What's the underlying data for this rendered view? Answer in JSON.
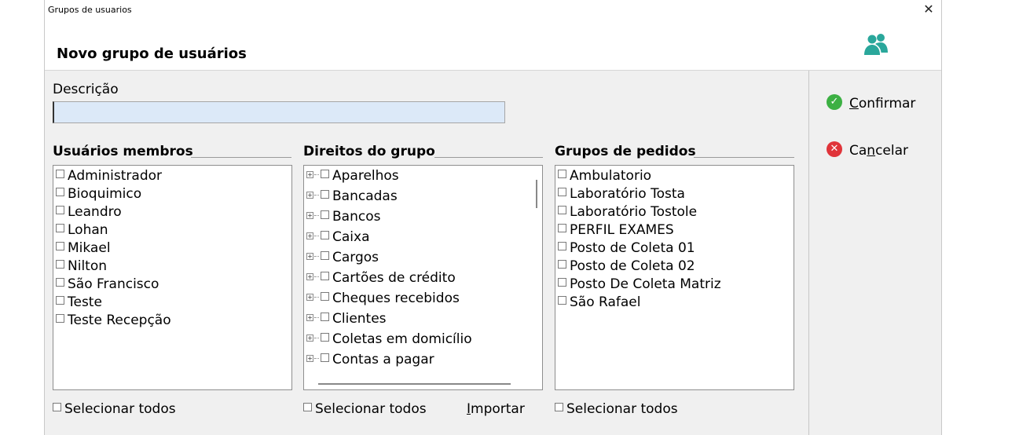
{
  "window": {
    "title": "Grupos de usuarios",
    "close_glyph": "✕"
  },
  "header": {
    "heading": "Novo grupo de usuários",
    "icon": "users-icon",
    "icon_color": "#2aa79b"
  },
  "description": {
    "label": "Descrição",
    "value": ""
  },
  "members": {
    "title": "Usuários membros",
    "items": [
      "Administrador",
      "Bioquimico",
      "Leandro",
      "Lohan",
      "Mikael",
      "Nilton",
      "São Francisco",
      "Teste",
      "Teste Recepção"
    ],
    "select_all": "Selecionar todos"
  },
  "rights": {
    "title": "Direitos do grupo",
    "items": [
      "Aparelhos",
      "Bancadas",
      "Bancos",
      "Caixa",
      "Cargos",
      "Cartões de crédito",
      "Cheques recebidos",
      "Clientes",
      "Coletas em domicílio",
      "Contas a pagar"
    ],
    "select_all": "Selecionar todos",
    "import_label": "Importar"
  },
  "orders": {
    "title": "Grupos de pedidos",
    "items": [
      "Ambulatorio",
      "Laboratório Tosta",
      "Laboratório Tostole",
      "PERFIL EXAMES",
      "Posto de Coleta 01",
      "Posto de Coleta 02",
      "Posto De Coleta Matriz",
      "São Rafael"
    ],
    "select_all": "Selecionar todos"
  },
  "actions": {
    "confirm": {
      "mnemonic": "C",
      "rest": "onfirmar",
      "color": "#3cb043"
    },
    "cancel": {
      "pre": "Ca",
      "mnemonic": "n",
      "rest": "celar",
      "color": "#e0343a"
    }
  }
}
